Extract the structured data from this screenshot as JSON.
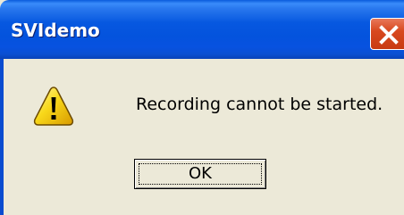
{
  "window": {
    "title": "SVIdemo",
    "close_icon": "close-icon"
  },
  "dialog": {
    "icon": "warning-icon",
    "message": "Recording cannot be started.",
    "ok_label": "OK"
  },
  "colors": {
    "titlebar": "#0453dd",
    "body": "#ece9d8",
    "close_button": "#d8491f",
    "warning_yellow": "#f8d81a"
  }
}
